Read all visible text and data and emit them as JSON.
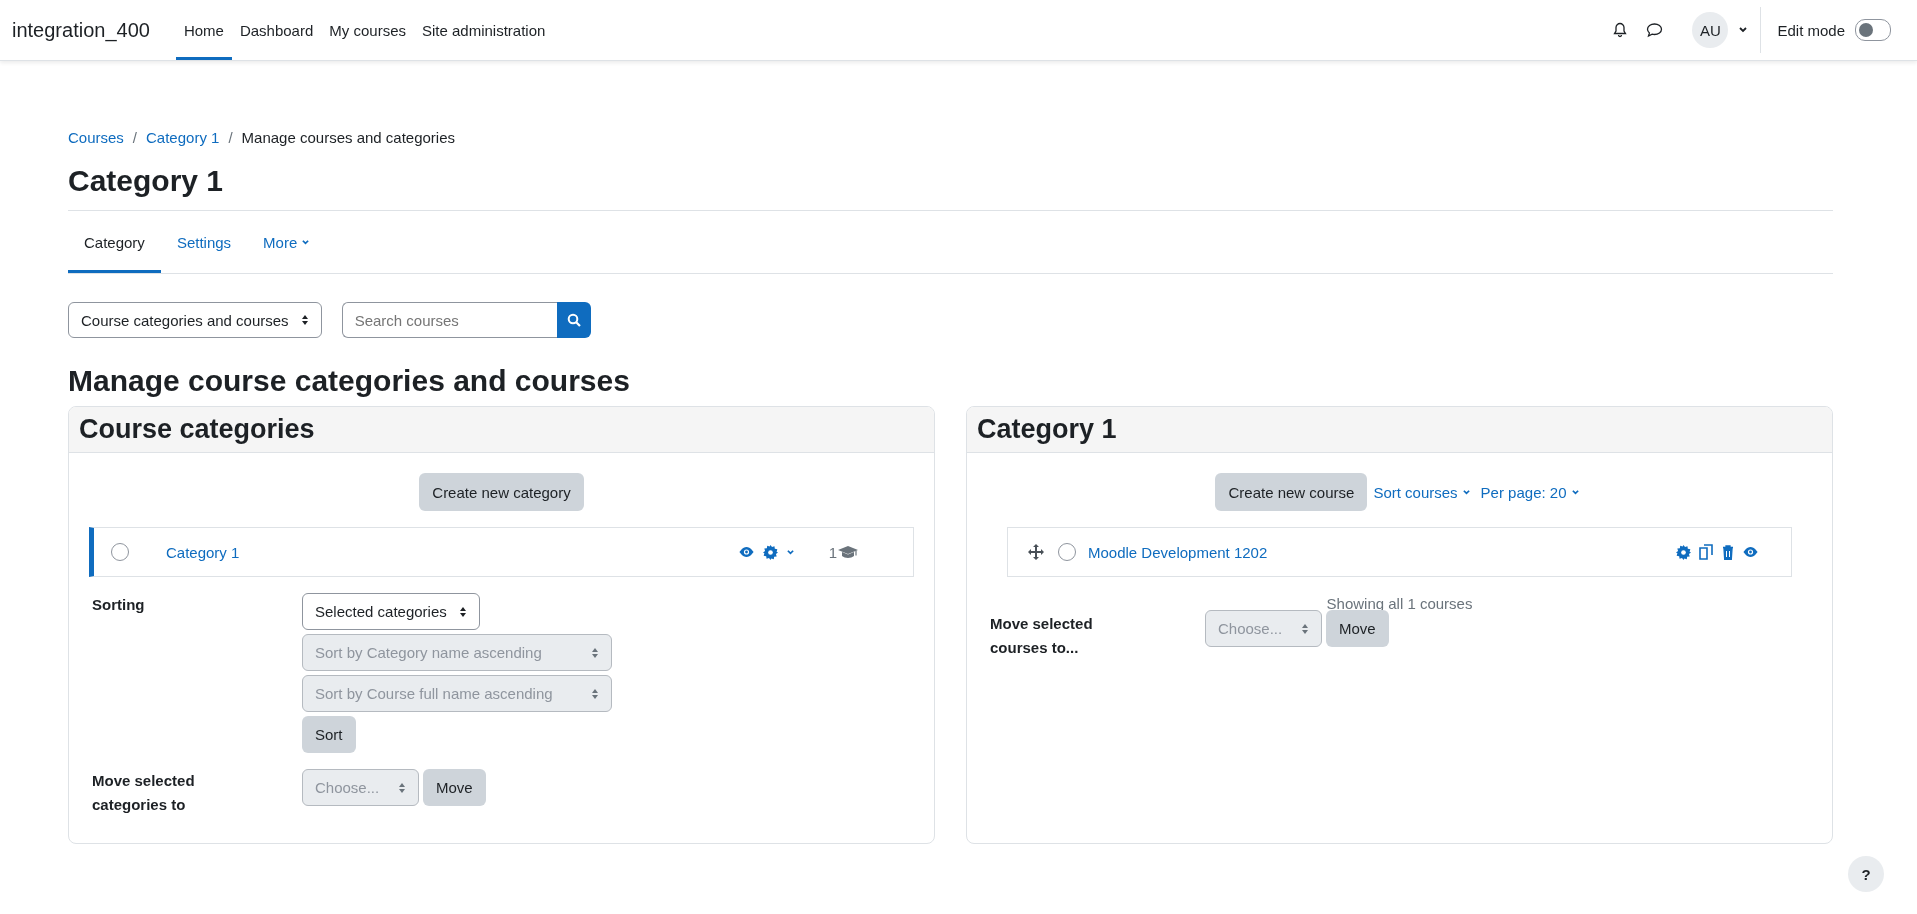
{
  "navbar": {
    "site_name": "integration_400",
    "items": [
      {
        "label": "Home",
        "selected": true
      },
      {
        "label": "Dashboard",
        "selected": false
      },
      {
        "label": "My courses",
        "selected": false
      },
      {
        "label": "Site administration",
        "selected": false
      }
    ],
    "user_initials": "AU",
    "edit_mode": {
      "label": "Edit mode",
      "on": false
    }
  },
  "breadcrumb": [
    {
      "label": "Courses",
      "link": true
    },
    {
      "separator": "/",
      "label": "Category 1",
      "link": true
    },
    {
      "separator": "/",
      "label": "Manage courses and categories",
      "link": false
    }
  ],
  "page_title": "Category 1",
  "tabs": [
    {
      "label": "Category",
      "selected": true,
      "has_menu": false
    },
    {
      "label": "Settings",
      "selected": false,
      "has_menu": false
    },
    {
      "label": "More",
      "selected": false,
      "has_menu": true
    }
  ],
  "view_select": "Course categories and courses",
  "search": {
    "placeholder": "Search courses"
  },
  "heading": "Manage course categories and courses",
  "categories_panel": {
    "title": "Course categories",
    "create_button": "Create new category",
    "rows": [
      {
        "name": "Category 1",
        "selected": true,
        "checked": false,
        "course_count": "1"
      }
    ],
    "sorting": {
      "label": "Sorting",
      "selects": [
        {
          "value": "Selected categories",
          "disabled": false
        },
        {
          "value": "Sort by Category name ascending",
          "disabled": true
        },
        {
          "value": "Sort by Course full name ascending",
          "disabled": true
        }
      ],
      "button": "Sort"
    },
    "move": {
      "label": "Move selected categories to",
      "select": "Choose...",
      "button": "Move"
    }
  },
  "courses_panel": {
    "title": "Category 1",
    "create_button": "Create new course",
    "sort_link": "Sort courses",
    "per_page": "Per page: 20",
    "rows": [
      {
        "name": "Moodle Development 1202",
        "checked": false
      }
    ],
    "summary": "Showing all 1 courses",
    "move": {
      "label": "Move selected courses to...",
      "select": "Choose...",
      "button": "Move"
    }
  },
  "help_button": "?"
}
